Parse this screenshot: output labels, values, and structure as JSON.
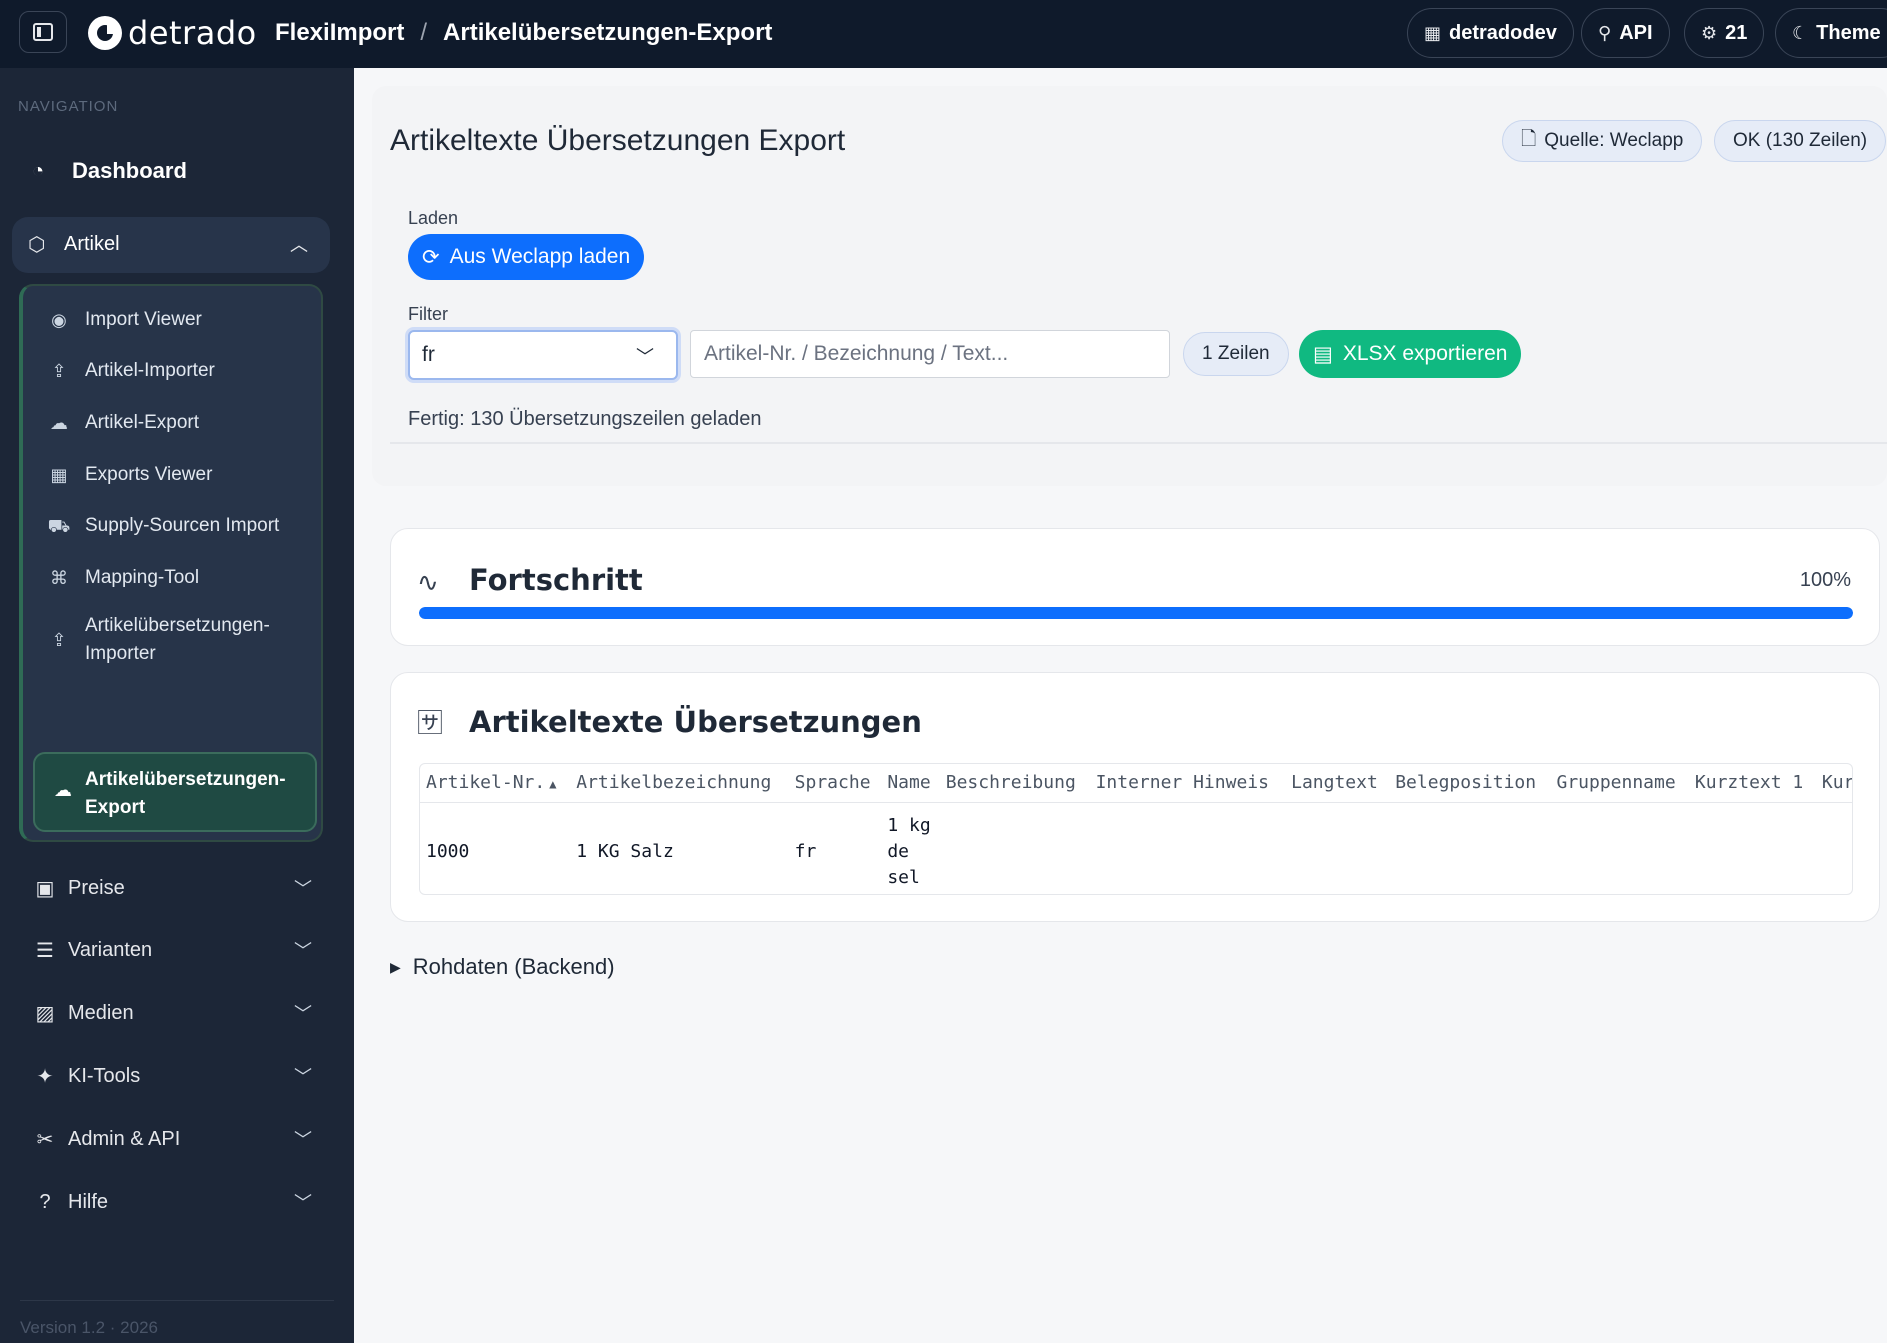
{
  "topbar": {
    "logo_text": "detrado",
    "breadcrumb": [
      "FlexiImport",
      "Artikelübersetzungen-Export"
    ],
    "breadcrumb_sep": "/",
    "pills": [
      {
        "icon": "building-icon",
        "label": "detradodev"
      },
      {
        "icon": "plug-icon",
        "label": "API"
      },
      {
        "icon": "chip-icon",
        "label": "21"
      },
      {
        "icon": "moon-icon",
        "label": "Theme"
      }
    ]
  },
  "sidebar": {
    "heading": "NAVIGATION",
    "dashboard": "Dashboard",
    "artikel": "Artikel",
    "sub_items": [
      {
        "icon": "eye-icon",
        "label": "Import Viewer"
      },
      {
        "icon": "upload-icon",
        "label": "Artikel-Importer"
      },
      {
        "icon": "cloud-download-icon",
        "label": "Artikel-Export"
      },
      {
        "icon": "table-icon",
        "label": "Exports Viewer"
      },
      {
        "icon": "truck-icon",
        "label": "Supply-Sourcen Import"
      },
      {
        "icon": "hierarchy-icon",
        "label": "Mapping-Tool"
      },
      {
        "icon": "upload-icon",
        "label": "Artikelübersetzungen-\nImporter"
      }
    ],
    "active_item": "Artikelübersetzungen-\nExport",
    "groups": [
      "Preise",
      "Varianten",
      "Medien",
      "KI-Tools",
      "Admin & API",
      "Hilfe"
    ],
    "version": "Version 1.2 · 2026"
  },
  "main": {
    "title": "Artikeltexte Übersetzungen Export",
    "badge_source": "Quelle: Weclapp",
    "badge_status": "OK (130 Zeilen)",
    "load_label": "Laden",
    "load_button": "Aus Weclapp laden",
    "filter_label": "Filter",
    "language_select": "fr",
    "search_placeholder": "Artikel-Nr. / Bezeichnung / Text...",
    "rows_count": "1 Zeilen",
    "export_button": "XLSX exportieren",
    "status": "Fertig: 130 Übersetzungszeilen geladen"
  },
  "progress": {
    "title": "Fortschritt",
    "percent_text": "100%",
    "percent": 100
  },
  "translations": {
    "title": "Artikeltexte Übersetzungen",
    "columns": [
      "Artikel-Nr.",
      "Artikelbezeichnung",
      "Sprache",
      "Name",
      "Beschreibung",
      "Interner Hinweis",
      "Langtext",
      "Belegposition",
      "Gruppenname",
      "Kurztext 1",
      "Kurztext"
    ],
    "rows": [
      {
        "artikel_nr": "1000",
        "bezeichnung": "1 KG Salz",
        "sprache": "fr",
        "name": "1 kg\nde\nsel"
      }
    ]
  },
  "raw_data": "Rohdaten (Backend)"
}
